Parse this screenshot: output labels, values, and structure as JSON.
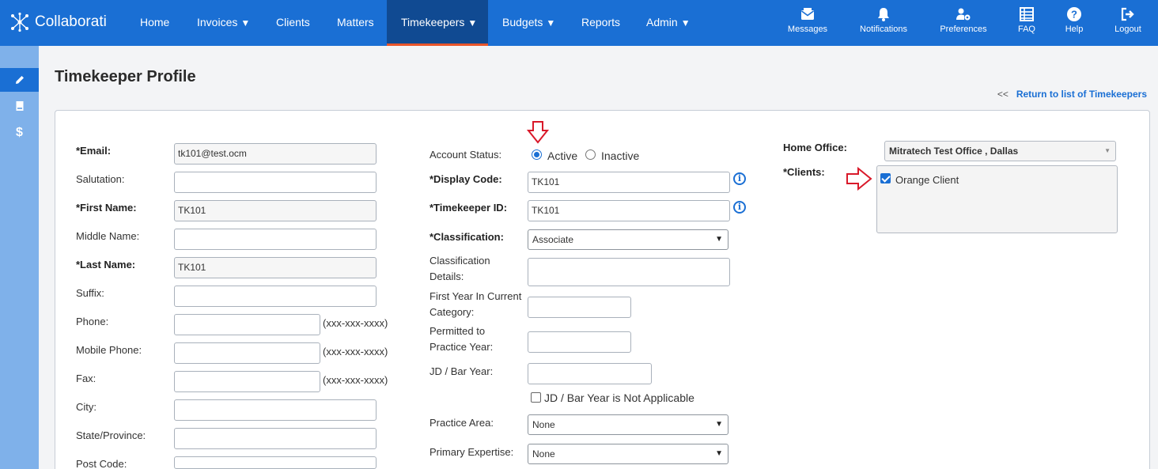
{
  "app": {
    "name": "Collaborati"
  },
  "nav": {
    "items": [
      {
        "label": "Home"
      },
      {
        "label": "Invoices"
      },
      {
        "label": "Clients"
      },
      {
        "label": "Matters"
      },
      {
        "label": "Timekeepers"
      },
      {
        "label": "Budgets"
      },
      {
        "label": "Reports"
      },
      {
        "label": "Admin"
      }
    ],
    "caret": "▼",
    "active": "Timekeepers"
  },
  "utility": [
    {
      "label": "Messages",
      "icon": "envelope-icon"
    },
    {
      "label": "Notifications",
      "icon": "bell-icon"
    },
    {
      "label": "Preferences",
      "icon": "user-gear-icon"
    },
    {
      "label": "FAQ",
      "icon": "table-list-icon"
    },
    {
      "label": "Help",
      "icon": "question-circle-icon"
    },
    {
      "label": "Logout",
      "icon": "logout-icon"
    }
  ],
  "sidebar": {
    "dollar": "$",
    "icons": [
      "pencil-icon",
      "document-icon",
      "dollar-icon"
    ]
  },
  "page": {
    "title": "Timekeeper Profile",
    "return_chevron": "<<",
    "return_link": "Return to list of Timekeepers"
  },
  "form": {
    "left": {
      "email": {
        "label": "*Email:",
        "value": "tk101@test.ocm"
      },
      "salutation": {
        "label": "Salutation:",
        "value": ""
      },
      "first_name": {
        "label": "*First Name:",
        "value": "TK101"
      },
      "middle_name": {
        "label": "Middle Name:",
        "value": ""
      },
      "last_name": {
        "label": "*Last Name:",
        "value": "TK101"
      },
      "suffix": {
        "label": "Suffix:",
        "value": ""
      },
      "phone": {
        "label": "Phone:",
        "value": "",
        "format": "(xxx-xxx-xxxx)"
      },
      "mobile": {
        "label": "Mobile Phone:",
        "value": "",
        "format": "(xxx-xxx-xxxx)"
      },
      "fax": {
        "label": "Fax:",
        "value": "",
        "format": "(xxx-xxx-xxxx)"
      },
      "city": {
        "label": "City:",
        "value": ""
      },
      "state": {
        "label": "State/Province:",
        "value": ""
      },
      "post_code": {
        "label": "Post Code:",
        "value": ""
      }
    },
    "middle": {
      "account_status": {
        "label": "Account Status:",
        "options": [
          "Active",
          "Inactive"
        ],
        "selected": "Active"
      },
      "display_code": {
        "label": "*Display Code:",
        "value": "TK101",
        "info": "i"
      },
      "timekeeper_id": {
        "label": "*Timekeeper ID:",
        "value": "TK101",
        "info": "i"
      },
      "classification": {
        "label": "*Classification:",
        "value": "Associate"
      },
      "classification_details": {
        "label": "Classification Details:",
        "value": ""
      },
      "first_year": {
        "label": "First Year In Current Category:",
        "value": ""
      },
      "permitted_year": {
        "label": "Permitted to Practice Year:",
        "value": ""
      },
      "jd_bar_year": {
        "label": "JD / Bar Year:",
        "value": ""
      },
      "jd_na": {
        "label": "JD / Bar Year is Not Applicable",
        "checked": false
      },
      "practice_area": {
        "label": "Practice Area:",
        "value": "None"
      },
      "primary_expertise": {
        "label": "Primary Expertise:",
        "value": "None"
      }
    },
    "right": {
      "home_office": {
        "label": "Home Office:",
        "value": "Mitratech Test Office , Dallas"
      },
      "clients": {
        "label": "*Clients:",
        "items": [
          {
            "label": "Orange Client",
            "checked": true
          }
        ]
      }
    }
  },
  "colors": {
    "primary": "#1a6fd4",
    "active_nav": "#104a92",
    "active_underline": "#e8552b",
    "annotation_arrow": "#d9192a",
    "sidebar": "#7fb1ea"
  }
}
